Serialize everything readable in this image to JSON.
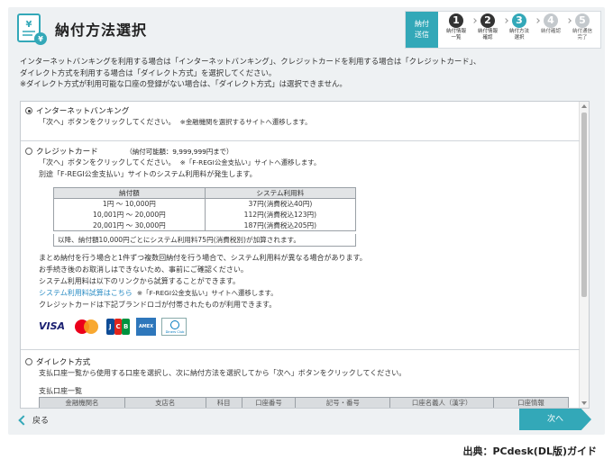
{
  "header": {
    "title": "納付方法選択"
  },
  "steps": {
    "current": "納付\n送信",
    "items": [
      {
        "num": "1",
        "label": "納付情報\n一覧",
        "state": "done"
      },
      {
        "num": "2",
        "label": "納付情報\n確認",
        "state": "done"
      },
      {
        "num": "3",
        "label": "納付方法\n選択",
        "state": "active"
      },
      {
        "num": "4",
        "label": "納付確認",
        "state": "todo"
      },
      {
        "num": "5",
        "label": "納付通信\n完了",
        "state": "todo"
      }
    ]
  },
  "intro": {
    "line1": "インターネットバンキングを利用する場合は「インターネットバンキング」、クレジットカードを利用する場合は「クレジットカード」、",
    "line2": "ダイレクト方式を利用する場合は「ダイレクト方式」を選択してください。",
    "line3": "※ダイレクト方式が利用可能な口座の登録がない場合は、「ダイレクト方式」は選択できません。"
  },
  "internet_banking": {
    "label": "インターネットバンキング",
    "desc": "「次へ」ボタンをクリックしてください。",
    "note": "※金融機関を選択するサイトへ遷移します。"
  },
  "credit_card": {
    "label": "クレジットカード",
    "limit": "（納付可能額：9,999,999円まで）",
    "desc": "「次へ」ボタンをクリックしてください。",
    "note": "※「F-REGI公金支払い」サイトへ遷移します。",
    "fee_notice": "別途「F-REGI公金支払い」サイトのシステム利用料が発生します。",
    "fee_table": {
      "headers": [
        "納付額",
        "システム利用料"
      ],
      "rows": [
        [
          "1円 ～ 10,000円",
          "37円(消費税込40円)"
        ],
        [
          "10,001円 ～ 20,000円",
          "112円(消費税込123円)"
        ],
        [
          "20,001円 ～ 30,000円",
          "187円(消費税込205円)"
        ]
      ],
      "footer": "以降、納付額10,000円ごとにシステム利用料75円(消費税別)が加算されます。"
    },
    "info1": "まとめ納付を行う場合と1件ずつ複数回納付を行う場合で、システム利用料が異なる場合があります。",
    "info2": "お手続き後のお取消しはできないため、事前にご確認ください。",
    "info3": "システム利用料は以下のリンクから試算することができます。",
    "calc_link": "システム利用料試算はこちら",
    "calc_note": "※「F-REGI公金支払い」サイトへ遷移します。",
    "brand_note": "クレジットカードは下記ブランドロゴが付帯されたものが利用できます。",
    "brands": {
      "visa": "VISA",
      "jcb": [
        "J",
        "C",
        "B"
      ],
      "amex": "AMEX",
      "diners": "Diners Club"
    }
  },
  "direct": {
    "label": "ダイレクト方式",
    "desc": "支払口座一覧から使用する口座を選択し、次に納付方法を選択してから「次へ」ボタンをクリックしてください。",
    "account_title": "支払口座一覧",
    "columns": [
      "金融機関名",
      "支店名",
      "科目",
      "口座番号",
      "記号・番号",
      "口座名義人（漢字）",
      "口座情報"
    ]
  },
  "footer": {
    "back": "戻る",
    "next": "次へ"
  },
  "credit": "出典：PCdesk(DL版)ガイド",
  "colors": {
    "accent": "#33a8b8",
    "link": "#2a8cc4"
  }
}
